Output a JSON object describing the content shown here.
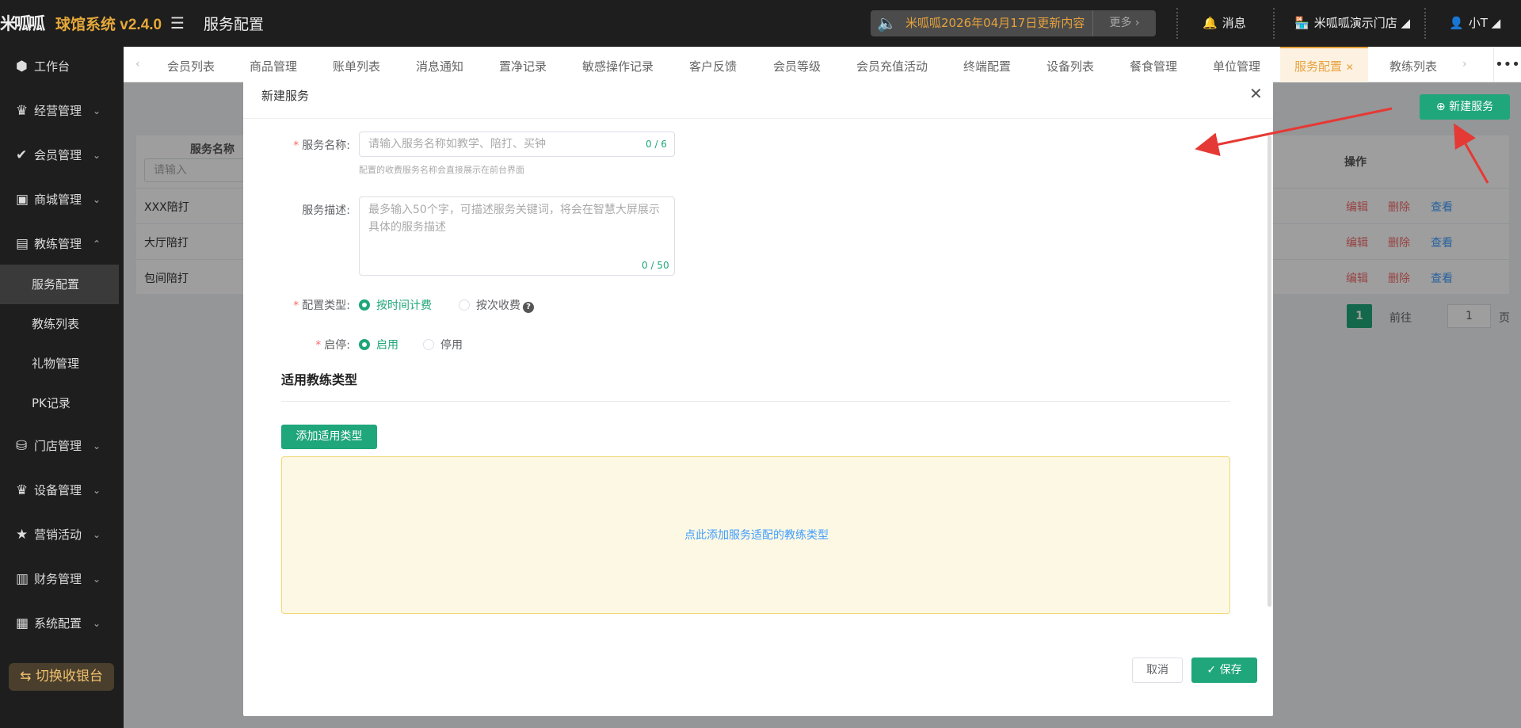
{
  "app": {
    "logo_text": "米呱呱",
    "title": "球馆系统 v2.4.0",
    "page_title": "服务配置"
  },
  "notice": {
    "text": "米呱呱2026年04月17日更新内容",
    "more": "更多"
  },
  "header": {
    "messages": "消息",
    "store": "米呱呱演示门店",
    "user": "小T"
  },
  "sidebar": {
    "items": [
      {
        "label": "工作台",
        "icon": "cube-icon"
      },
      {
        "label": "经营管理",
        "icon": "crown-icon"
      },
      {
        "label": "会员管理",
        "icon": "v-icon"
      },
      {
        "label": "商城管理",
        "icon": "shop-icon"
      },
      {
        "label": "教练管理",
        "icon": "coach-icon"
      },
      {
        "label": "门店管理",
        "icon": "coins-icon"
      },
      {
        "label": "设备管理",
        "icon": "crown-icon"
      },
      {
        "label": "营销活动",
        "icon": "star-icon"
      },
      {
        "label": "财务管理",
        "icon": "chart-icon"
      },
      {
        "label": "系统配置",
        "icon": "grid-icon"
      }
    ],
    "sub_items": [
      "服务配置",
      "教练列表",
      "礼物管理",
      "PK记录"
    ],
    "switch": "切换收银台"
  },
  "tabs": [
    "会员列表",
    "商品管理",
    "账单列表",
    "消息通知",
    "置净记录",
    "敏感操作记录",
    "客户反馈",
    "会员等级",
    "会员充值活动",
    "终端配置",
    "设备列表",
    "餐食管理",
    "单位管理",
    "服务配置",
    "教练列表"
  ],
  "background": {
    "column_name": "服务名称",
    "column_ops": "操作",
    "filter_placeholder": "请输入",
    "rows": [
      "XXX陪打",
      "大厅陪打",
      "包间陪打"
    ],
    "ops": {
      "edit": "编辑",
      "delete": "删除",
      "view": "查看"
    },
    "new_button": "新建服务",
    "pager": {
      "current": "1",
      "goto": "前往",
      "page_input": "1",
      "page_unit": "页"
    }
  },
  "dialog": {
    "title": "新建服务",
    "name_label": "服务名称:",
    "name_placeholder": "请输入服务名称如教学、陪打、买钟",
    "name_count": "0 / 6",
    "name_hint": "配置的收费服务名称会直接展示在前台界面",
    "desc_label": "服务描述:",
    "desc_placeholder": "最多输入50个字，可描述服务关键词，将会在智慧大屏展示具体的服务描述",
    "desc_count": "0 / 50",
    "type_label": "配置类型:",
    "type_options": [
      "按时间计费",
      "按次收费"
    ],
    "status_label": "启停:",
    "status_options": [
      "启用",
      "停用"
    ],
    "section_title": "适用教练类型",
    "add_type_button": "添加适用类型",
    "drop_text": "点此添加服务适配的教练类型",
    "cancel": "取消",
    "save": "保存"
  },
  "colors": {
    "primary": "#1fa67a",
    "accent": "#e6a23c",
    "danger": "#f56c6c",
    "link": "#409eff",
    "arrow": "#e53935"
  }
}
